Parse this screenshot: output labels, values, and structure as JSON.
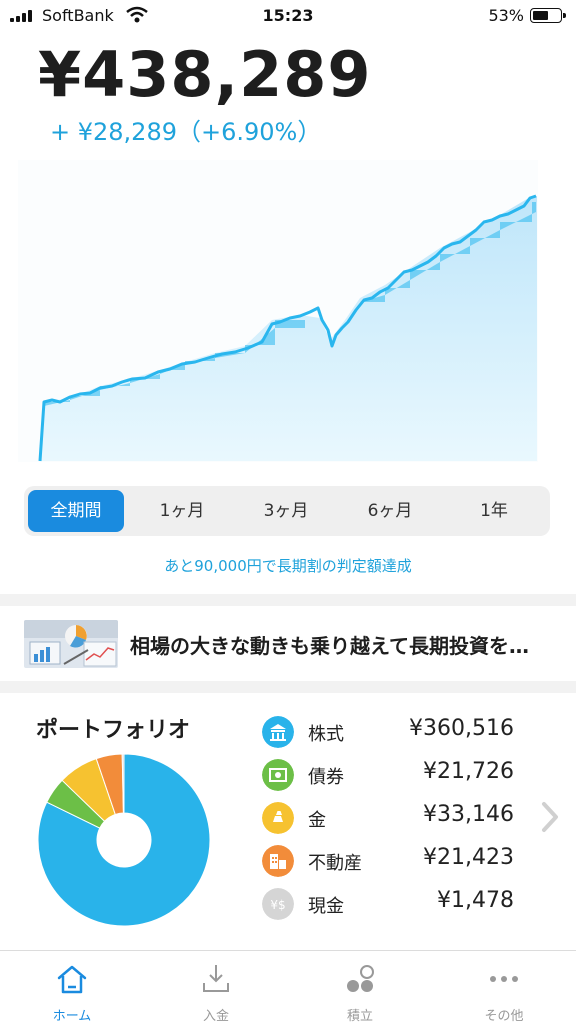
{
  "status_bar": {
    "carrier": "SoftBank",
    "time": "15:23",
    "battery": "53%"
  },
  "summary": {
    "total": "¥438,289",
    "gain": "+ ¥28,289（+6.90%）"
  },
  "chart_data": {
    "type": "area",
    "color": "#2ab8ee",
    "note": "asset value over full period, stepped area with line"
  },
  "periods": {
    "items": [
      {
        "label": "全期間",
        "active": true
      },
      {
        "label": "1ヶ月",
        "active": false
      },
      {
        "label": "3ヶ月",
        "active": false
      },
      {
        "label": "6ヶ月",
        "active": false
      },
      {
        "label": "1年",
        "active": false
      }
    ],
    "notice": "あと90,000円で長期割の判定額達成"
  },
  "news": {
    "title": "相場の大きな動きも乗り越えて長期投資を…"
  },
  "portfolio": {
    "title": "ポートフォリオ",
    "assets": [
      {
        "name": "株式",
        "amount": "¥360,516",
        "value": 360516,
        "color": "#29b3ea",
        "icon": "bank-building-icon"
      },
      {
        "name": "債券",
        "amount": "¥21,726",
        "value": 21726,
        "color": "#6cbf47",
        "icon": "bond-certificate-icon"
      },
      {
        "name": "金",
        "amount": "¥33,146",
        "value": 33146,
        "color": "#f6c230",
        "icon": "gold-bars-icon"
      },
      {
        "name": "不動産",
        "amount": "¥21,423",
        "value": 21423,
        "color": "#f28c3a",
        "icon": "real-estate-icon"
      },
      {
        "name": "現金",
        "amount": "¥1,478",
        "value": 1478,
        "color": "#d5d5d5",
        "icon": "cash-yen-dollar-icon"
      }
    ]
  },
  "tabbar": {
    "items": [
      {
        "label": "ホーム",
        "icon": "home-icon",
        "active": true
      },
      {
        "label": "入金",
        "icon": "deposit-icon",
        "active": false
      },
      {
        "label": "積立",
        "icon": "accumulate-icon",
        "active": false
      },
      {
        "label": "その他",
        "icon": "more-dots-icon",
        "active": false
      }
    ]
  }
}
